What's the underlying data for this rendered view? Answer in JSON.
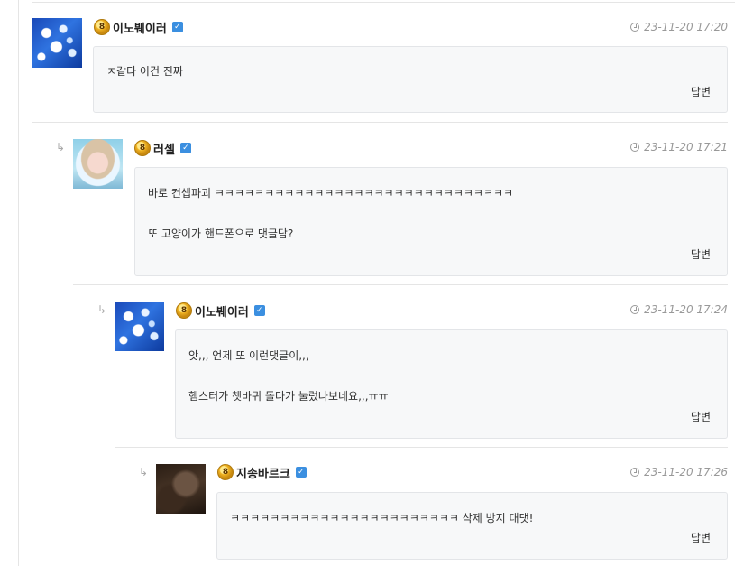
{
  "comments": [
    {
      "author": "이노붸이러",
      "level": "8",
      "time": "23-11-20 17:20",
      "lines": [
        "ㅈ같다 이건 진짜"
      ],
      "reply_label": "답변"
    },
    {
      "author": "러셀",
      "level": "8",
      "time": "23-11-20 17:21",
      "lines": [
        "바로 컨셉파괴 ㅋㅋㅋㅋㅋㅋㅋㅋㅋㅋㅋㅋㅋㅋㅋㅋㅋㅋㅋㅋㅋㅋㅋㅋㅋㅋㅋㅋㅋㅋ",
        "또 고양이가 핸드폰으로 댓글담?"
      ],
      "reply_label": "답변"
    },
    {
      "author": "이노붸이러",
      "level": "8",
      "time": "23-11-20 17:24",
      "lines": [
        "앗,,, 언제 또 이런댓글이,,,",
        "햄스터가 쳇바퀴 돌다가  눌렀나보네요,,,ㅠㅠ"
      ],
      "reply_label": "답변"
    },
    {
      "author": "지송바르크",
      "level": "8",
      "time": "23-11-20 17:26",
      "lines": [
        "ㅋㅋㅋㅋㅋㅋㅋㅋㅋㅋㅋㅋㅋㅋㅋㅋㅋㅋㅋㅋㅋㅋㅋ 삭제 방지 대댓!"
      ],
      "reply_label": "답변"
    }
  ],
  "icons": {
    "reply_arrow": "↳",
    "verified": "✓",
    "clock": "clock-icon"
  },
  "colors": {
    "verified_blue": "#3b8fe0",
    "bubble_bg": "#f7f8f9",
    "border": "#e3e5e8",
    "time_gray": "#999999"
  }
}
